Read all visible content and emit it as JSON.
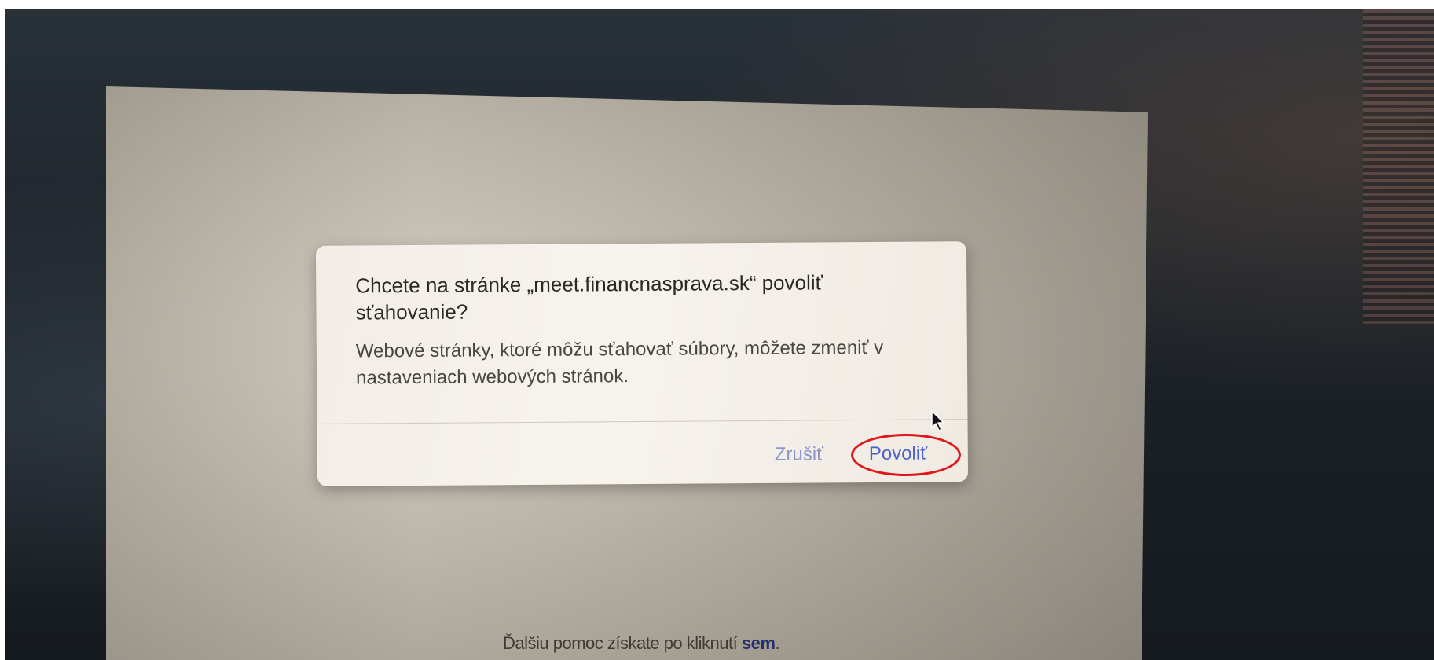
{
  "dialog": {
    "title": "Chcete na stránke „meet.financnasprava.sk“ povoliť sťahovanie?",
    "message": "Webové stránky, ktoré môžu sťahovať súbory, môžete zmeniť v nastaveniach webových stránok.",
    "cancel_label": "Zrušiť",
    "allow_label": "Povoliť"
  },
  "footer": {
    "text": "Ďalšiu pomoc získate po kliknutí",
    "link_label": "sem",
    "trailing": "."
  },
  "colors": {
    "accent": "#4f62c9",
    "highlight": "#e0161b"
  },
  "icons": {
    "cursor": "mouse-pointer-icon"
  }
}
